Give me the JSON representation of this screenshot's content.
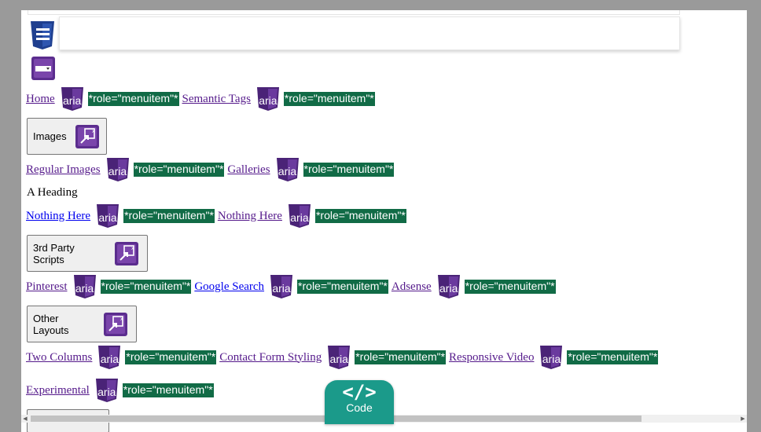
{
  "menu": {
    "row1": [
      {
        "label": "Home",
        "role": "*role=\"menuitem\"*",
        "aria": "aria"
      },
      {
        "label": "Semantic Tags",
        "role": "*role=\"menuitem\"*",
        "aria": "aria"
      }
    ],
    "images_button": "Images",
    "row2": [
      {
        "label": "Regular Images",
        "role": "*role=\"menuitem\"*",
        "aria": "aria"
      },
      {
        "label": "Galleries",
        "role": "*role=\"menuitem\"*",
        "aria": "aria"
      }
    ],
    "heading": "A Heading",
    "row3": [
      {
        "label": "Nothing Here",
        "role": "*role=\"menuitem\"*",
        "aria": "aria"
      },
      {
        "label": "Nothing Here",
        "role": "*role=\"menuitem\"*",
        "aria": "aria"
      }
    ],
    "scripts_button": "3rd Party Scripts",
    "row4": [
      {
        "label": "Pinterest",
        "role": "*role=\"menuitem\"*",
        "aria": "aria"
      },
      {
        "label": "Google Search",
        "role": "*role=\"menuitem\"*",
        "aria": "aria"
      },
      {
        "label": "Adsense",
        "role": "*role=\"menuitem\"*",
        "aria": "aria"
      }
    ],
    "layouts_button": "Other Layouts",
    "row5": [
      {
        "label": "Two Columns",
        "role": "*role=\"menuitem\"*",
        "aria": "aria"
      },
      {
        "label": "Contact Form Styling",
        "role": "*role=\"menuitem\"*",
        "aria": "aria"
      },
      {
        "label": "Responsive Video",
        "role": "*role=\"menuitem\"*",
        "aria": "aria"
      }
    ],
    "row6": [
      {
        "label": "Experimental",
        "role": "*role=\"menuitem\"*",
        "aria": "aria"
      }
    ]
  },
  "code_button": {
    "glyph": "</>",
    "label": "Code"
  },
  "icons": {
    "menu": "hamburger-menu-icon",
    "select": "dropdown-select-icon",
    "aria": "aria-badge-icon",
    "external": "external-popup-icon"
  },
  "colors": {
    "role_badge": "#116b46",
    "aria_badge": "#5b2d8e",
    "code_button": "#1b9a8a",
    "menu_icon": "#1f3f8f"
  }
}
